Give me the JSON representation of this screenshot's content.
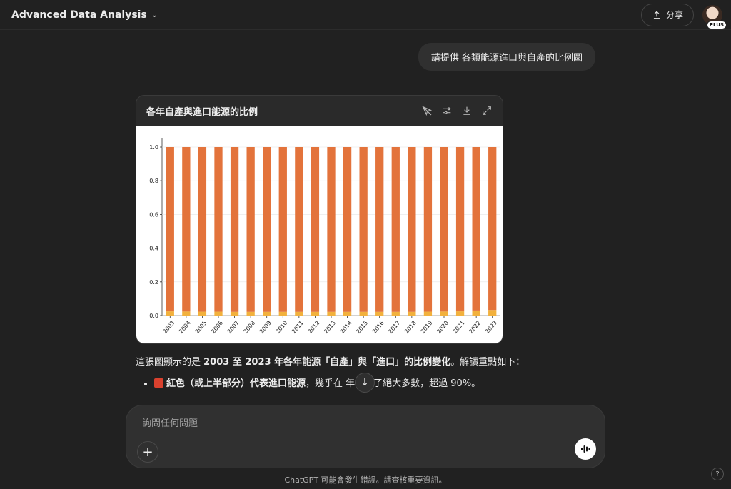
{
  "header": {
    "model_name": "Advanced Data Analysis",
    "share_label": "分享",
    "plan_badge": "PLUS"
  },
  "user_message": "請提供 各類能源進口與自產的比例圖",
  "chart_card": {
    "title": "各年自產與進口能源的比例"
  },
  "chart_data": {
    "type": "bar",
    "stacked": true,
    "title": "",
    "xlabel": "",
    "ylabel": "",
    "ylim": [
      0,
      1.0
    ],
    "yticks": [
      "0.0",
      "0.2",
      "0.4",
      "0.6",
      "0.8",
      "1.0"
    ],
    "categories": [
      "2003",
      "2004",
      "2005",
      "2006",
      "2007",
      "2008",
      "2009",
      "2010",
      "2011",
      "2012",
      "2013",
      "2014",
      "2015",
      "2016",
      "2017",
      "2018",
      "2019",
      "2020",
      "2021",
      "2022",
      "2023"
    ],
    "series": [
      {
        "values": [
          0.025,
          0.024,
          0.023,
          0.023,
          0.022,
          0.022,
          0.022,
          0.022,
          0.022,
          0.022,
          0.022,
          0.022,
          0.022,
          0.022,
          0.022,
          0.022,
          0.023,
          0.024,
          0.025,
          0.03,
          0.033
        ],
        "color": "#f2b13d"
      },
      {
        "values": [
          0.975,
          0.976,
          0.977,
          0.977,
          0.978,
          0.978,
          0.978,
          0.978,
          0.978,
          0.978,
          0.978,
          0.978,
          0.978,
          0.978,
          0.978,
          0.978,
          0.977,
          0.976,
          0.975,
          0.97,
          0.967
        ],
        "color": "#e3733b"
      }
    ],
    "legend": {
      "title": "",
      "position": "top-right"
    },
    "grid": true
  },
  "answer": {
    "intro_pre": "這張圖顯示的是 ",
    "intro_bold": "2003 至 2023 年各年能源「自產」與「進口」的比例變化",
    "intro_post": "。解讀重點如下：",
    "bullet1_bold": "紅色（或上半部分）代表進口能源",
    "bullet1_text": "，幾乎在  年都占了絕大多數，超過 90%。",
    "bullet1_color": "#d9412e"
  },
  "composer": {
    "placeholder": "詢問任何問題"
  },
  "footer": {
    "note": "ChatGPT 可能會發生錯誤。請查核重要資訊。",
    "help": "?"
  }
}
